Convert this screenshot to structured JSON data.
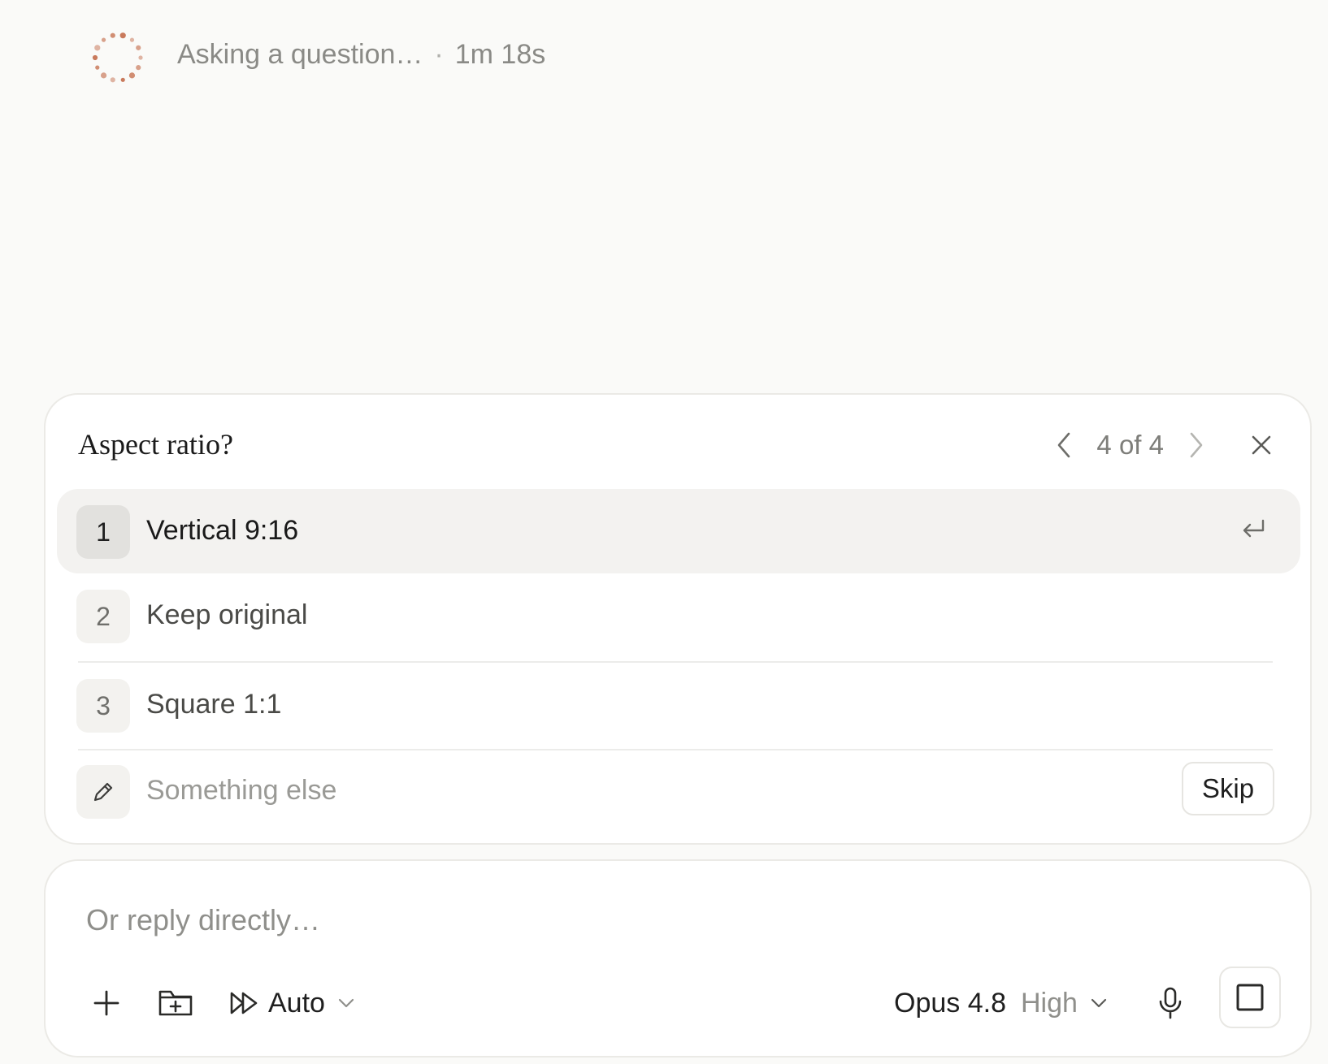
{
  "status": {
    "text": "Asking a question…",
    "separator": "·",
    "elapsed": "1m 18s",
    "spinner_color": "#c97a5c"
  },
  "question": {
    "title": "Aspect ratio?",
    "counter": "4 of 4",
    "options": [
      {
        "num": "1",
        "label": "Vertical 9:16"
      },
      {
        "num": "2",
        "label": "Keep original"
      },
      {
        "num": "3",
        "label": "Square 1:1"
      }
    ],
    "other_placeholder": "Something else",
    "skip_label": "Skip"
  },
  "composer": {
    "placeholder": "Or reply directly…",
    "mode_label": "Auto",
    "model": "Opus 4.8",
    "effort": "High"
  },
  "colors": {
    "accent": "#c97a5c",
    "background": "#fafaf8",
    "selected_row": "#f3f2f0"
  }
}
